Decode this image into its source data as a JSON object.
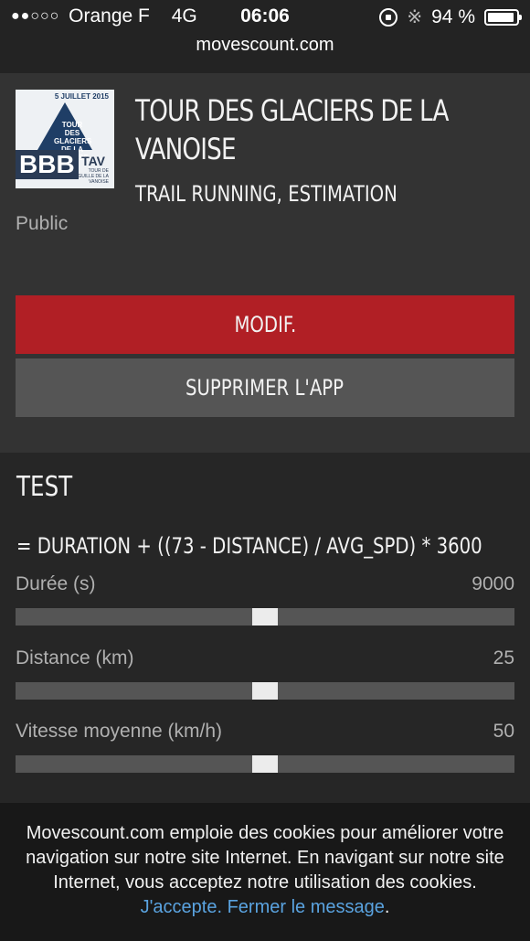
{
  "status_bar": {
    "signal_dots": "●●○○○",
    "carrier": "Orange F",
    "network": "4G",
    "time": "06:06",
    "battery": "94 %",
    "battery_level": 0.94,
    "icons": [
      "rotation-lock-icon",
      "bluetooth-icon",
      "battery-icon"
    ]
  },
  "browser": {
    "url": "movescount.com"
  },
  "app": {
    "thumbnail": {
      "date": "5 JUILLET 2015",
      "name": "TOUR DES GLACIERS DE LA VANOISE",
      "big": "BBB",
      "tav": "TAV",
      "sub": "TOUR DE L'AIGUILLE DE LA VANOISE"
    },
    "title": "TOUR DES GLACIERS DE LA VANOISE",
    "subtitle": "TRAIL RUNNING, ESTIMATION",
    "visibility": "Public",
    "edit_label": "MODIF.",
    "delete_label": "SUPPRIMER L'APP",
    "colors": {
      "edit": "#b11f25",
      "delete": "#555555"
    }
  },
  "test": {
    "title": "TEST",
    "formula": "= DURATION + ((73 - DISTANCE) / AVG_SPD) * 3600",
    "params": [
      {
        "label": "Durée (s)",
        "value": "9000",
        "slider_fraction": 0.5
      },
      {
        "label": "Distance (km)",
        "value": "25",
        "slider_fraction": 0.5
      },
      {
        "label": "Vitesse moyenne (km/h)",
        "value": "50",
        "slider_fraction": 0.5
      }
    ]
  },
  "cookie_banner": {
    "text": "Movescount.com emploie des cookies pour améliorer votre navigation sur notre site Internet. En navigant sur notre site Internet, vous acceptez notre utilisation des cookies. ",
    "accept_label": "J'accepte.",
    "close_label": "Fermer le message",
    "trailing": "."
  }
}
